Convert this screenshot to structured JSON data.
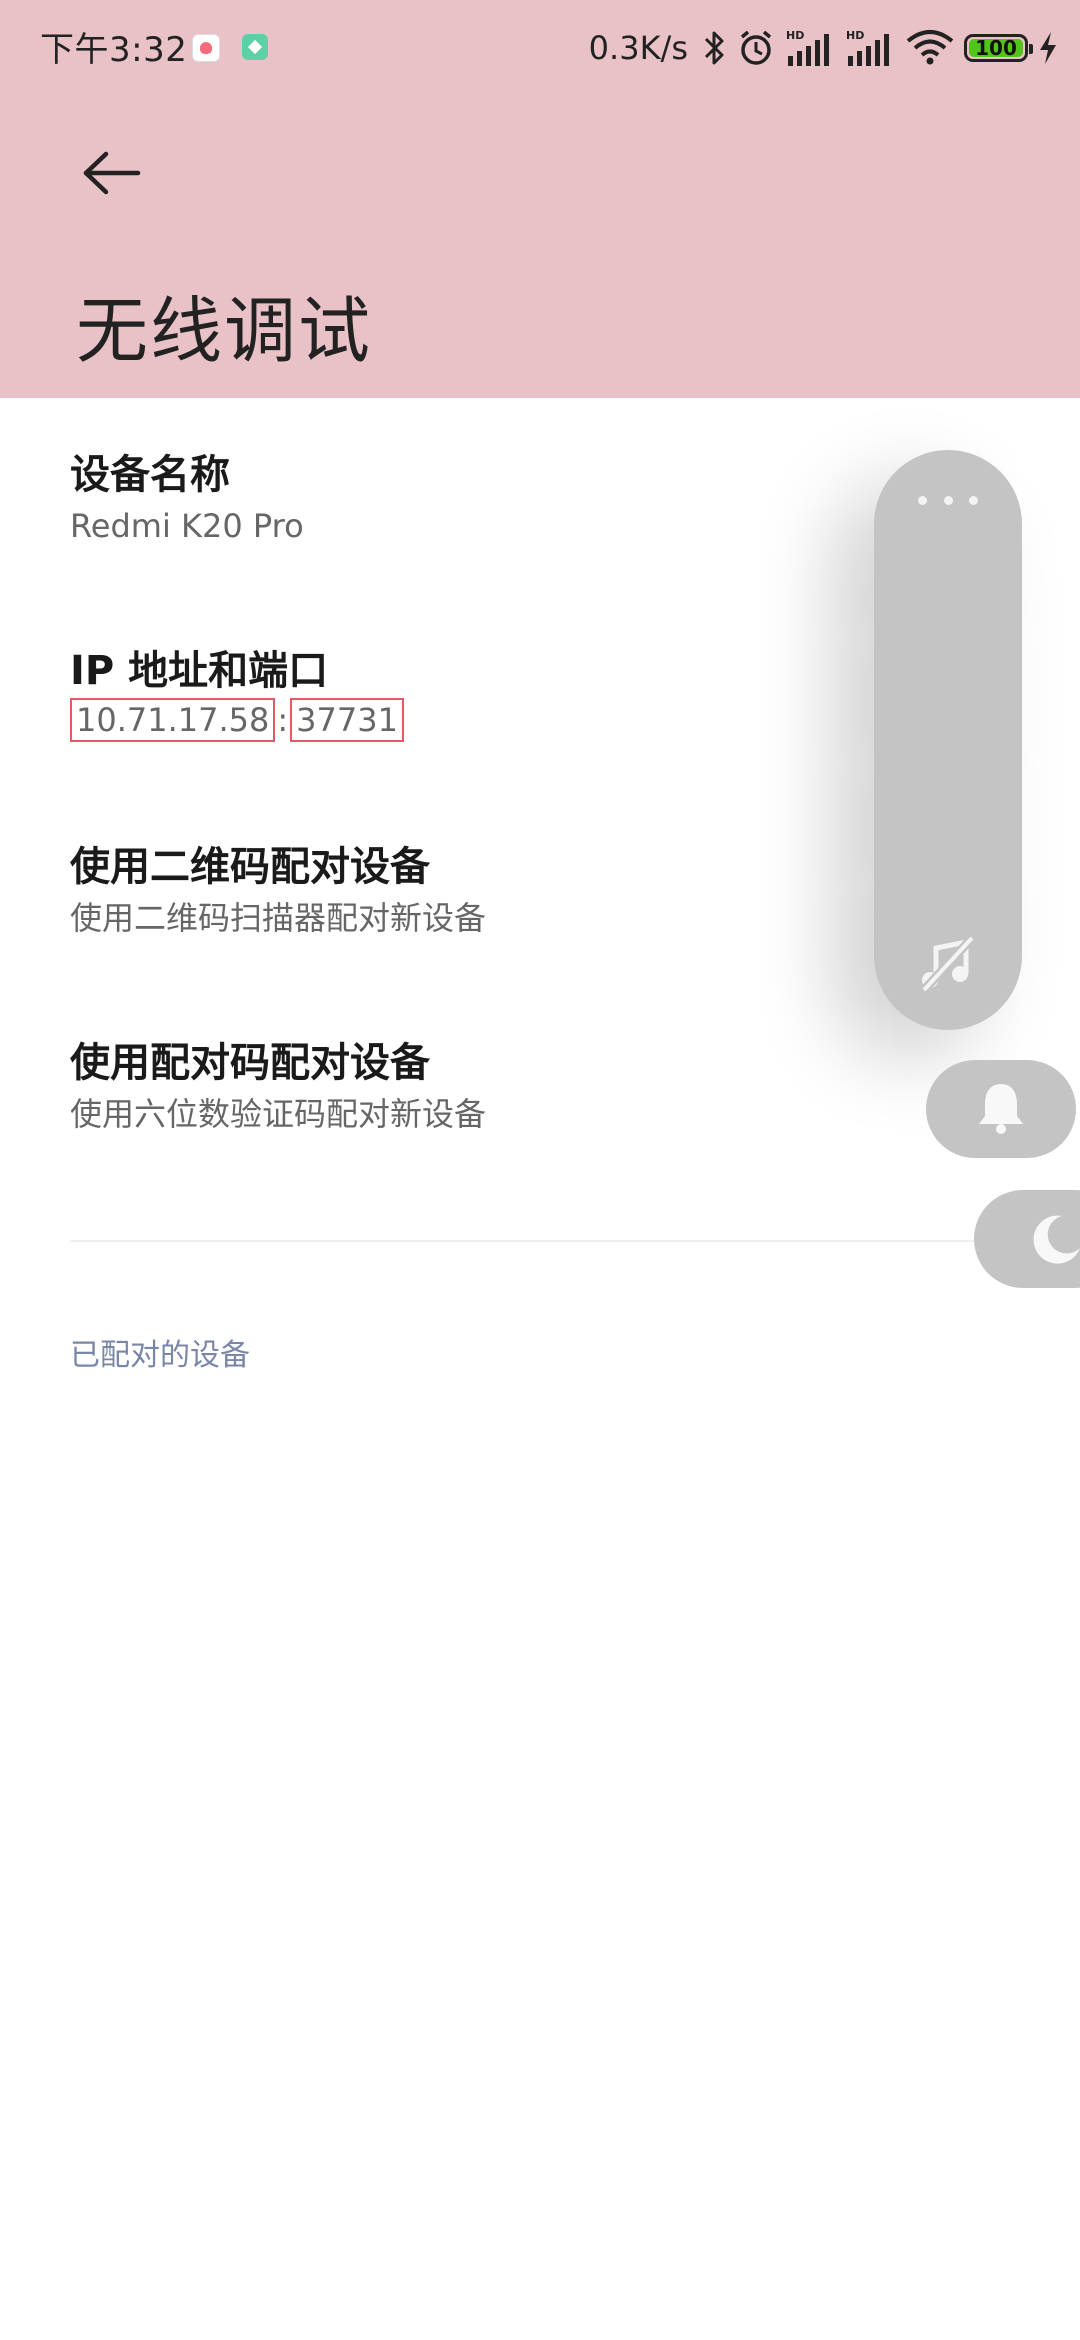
{
  "status_bar": {
    "time": "下午3:32",
    "net_speed": "0.3K/s",
    "battery_level": "100",
    "battery_fraction": 1.0,
    "icons": [
      "health-app-icon",
      "green-app-icon",
      "bluetooth-icon",
      "alarm-icon",
      "signal-hd-icon",
      "signal-hd-icon",
      "wifi-icon",
      "battery-icon",
      "charging-icon"
    ],
    "colors": {
      "battery_fill": "#52c41a"
    }
  },
  "header": {
    "back_icon": "back-arrow-icon",
    "title": "无线调试",
    "background": "#e9c2c8"
  },
  "items": [
    {
      "title": "设备名称",
      "subtitle": "Redmi K20 Pro"
    },
    {
      "title": "IP 地址和端口",
      "ip": "10.71.17.58",
      "separator": ":",
      "port": "37731"
    },
    {
      "title": "使用二维码配对设备",
      "subtitle": "使用二维码扫描器配对新设备"
    },
    {
      "title": "使用配对码配对设备",
      "subtitle": "使用六位数验证码配对新设备"
    }
  ],
  "section": {
    "paired_label": "已配对的设备"
  },
  "floating_panel": {
    "icons": [
      "more-dots-icon",
      "music-off-icon",
      "bell-icon",
      "moon-icon"
    ],
    "color": "#c4c4c4"
  }
}
